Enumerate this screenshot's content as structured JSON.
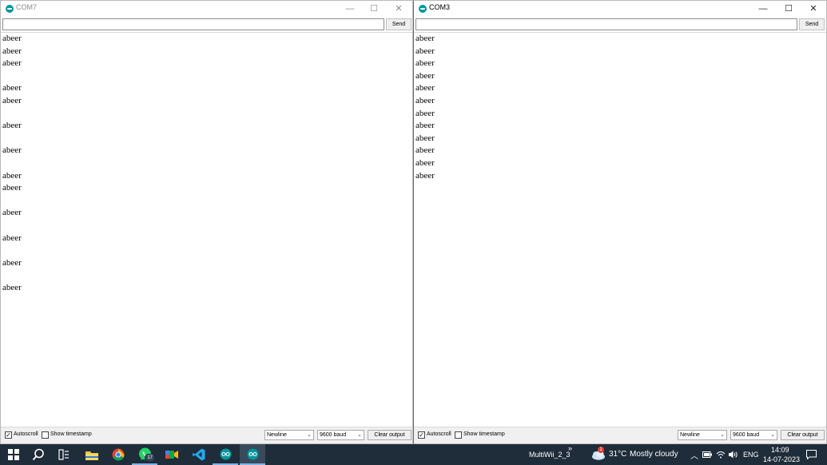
{
  "left_window": {
    "title": "COM7",
    "send_label": "Send",
    "input_value": "",
    "lines": [
      "abeer",
      "abeer",
      "abeer",
      "",
      "abeer",
      "abeer",
      "",
      "abeer",
      "",
      "abeer",
      "",
      "abeer",
      "abeer",
      "",
      "abeer",
      "",
      "abeer",
      "",
      "abeer",
      "",
      "abeer"
    ],
    "autoscroll_label": "Autoscroll",
    "timestamp_label": "Show timestamp",
    "line_ending": "Newline",
    "baud": "9600 baud",
    "clear_label": "Clear output"
  },
  "right_window": {
    "title": "COM3",
    "send_label": "Send",
    "input_value": "",
    "lines": [
      "abeer",
      "abeer",
      "abeer",
      "abeer",
      "abeer",
      "abeer",
      "abeer",
      "abeer",
      "abeer",
      "abeer",
      "abeer",
      "abeer"
    ],
    "autoscroll_label": "Autoscroll",
    "timestamp_label": "Show timestamp",
    "line_ending": "Newline",
    "baud": "9600 baud",
    "clear_label": "Clear output"
  },
  "window_controls": {
    "minimize": "—",
    "maximize": "☐",
    "close": "✕"
  },
  "taskbar": {
    "whatsapp_badge": "17",
    "app_label": "MultiWii_2_3",
    "chevron": "»",
    "weather_temp": "31°C",
    "weather_desc": "Mostly cloudy",
    "weather_alert": "1",
    "language": "ENG",
    "time": "14:09",
    "date": "14-07-2023"
  },
  "colors": {
    "arduino_teal": "#00979c",
    "taskbar_bg": "#1f2c3a"
  }
}
